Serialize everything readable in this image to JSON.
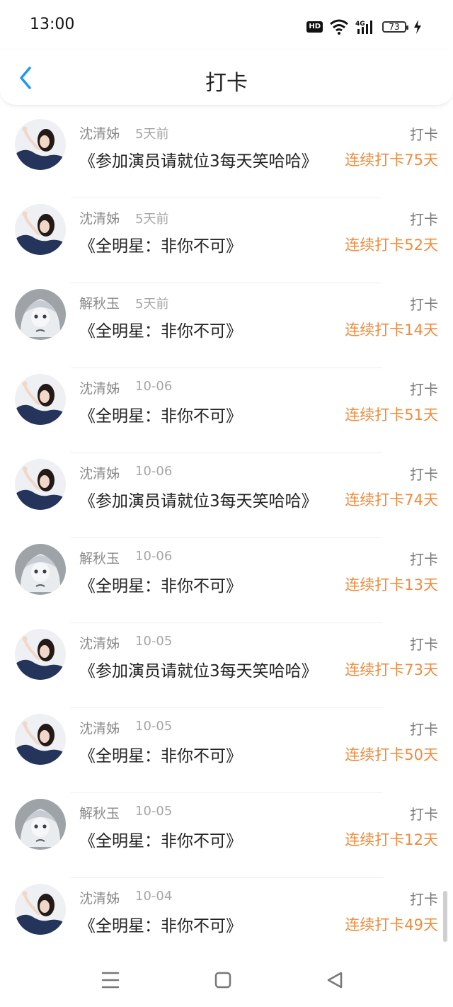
{
  "status_bar": {
    "time": "13:00",
    "hd": "HD",
    "battery": "73"
  },
  "header": {
    "title": "打卡"
  },
  "list": [
    {
      "name": "沈清姊",
      "time": "5天前",
      "work": "《参加演员请就位3每天笑哈哈》",
      "kind": "打卡",
      "streak": "连续打卡75天",
      "avatar": "female"
    },
    {
      "name": "沈清姊",
      "time": "5天前",
      "work": "《全明星：非你不可》",
      "kind": "打卡",
      "streak": "连续打卡52天",
      "avatar": "female"
    },
    {
      "name": "解秋玉",
      "time": "5天前",
      "work": "《全明星：非你不可》",
      "kind": "打卡",
      "streak": "连续打卡14天",
      "avatar": "anime"
    },
    {
      "name": "沈清姊",
      "time": "10-06",
      "work": "《全明星：非你不可》",
      "kind": "打卡",
      "streak": "连续打卡51天",
      "avatar": "female"
    },
    {
      "name": "沈清姊",
      "time": "10-06",
      "work": "《参加演员请就位3每天笑哈哈》",
      "kind": "打卡",
      "streak": "连续打卡74天",
      "avatar": "female"
    },
    {
      "name": "解秋玉",
      "time": "10-06",
      "work": "《全明星：非你不可》",
      "kind": "打卡",
      "streak": "连续打卡13天",
      "avatar": "anime"
    },
    {
      "name": "沈清姊",
      "time": "10-05",
      "work": "《参加演员请就位3每天笑哈哈》",
      "kind": "打卡",
      "streak": "连续打卡73天",
      "avatar": "female"
    },
    {
      "name": "沈清姊",
      "time": "10-05",
      "work": "《全明星：非你不可》",
      "kind": "打卡",
      "streak": "连续打卡50天",
      "avatar": "female"
    },
    {
      "name": "解秋玉",
      "time": "10-05",
      "work": "《全明星：非你不可》",
      "kind": "打卡",
      "streak": "连续打卡12天",
      "avatar": "anime"
    },
    {
      "name": "沈清姊",
      "time": "10-04",
      "work": "《全明星：非你不可》",
      "kind": "打卡",
      "streak": "连续打卡49天",
      "avatar": "female"
    }
  ],
  "colors": {
    "accent": "#f08a3c",
    "back": "#2196f3"
  }
}
